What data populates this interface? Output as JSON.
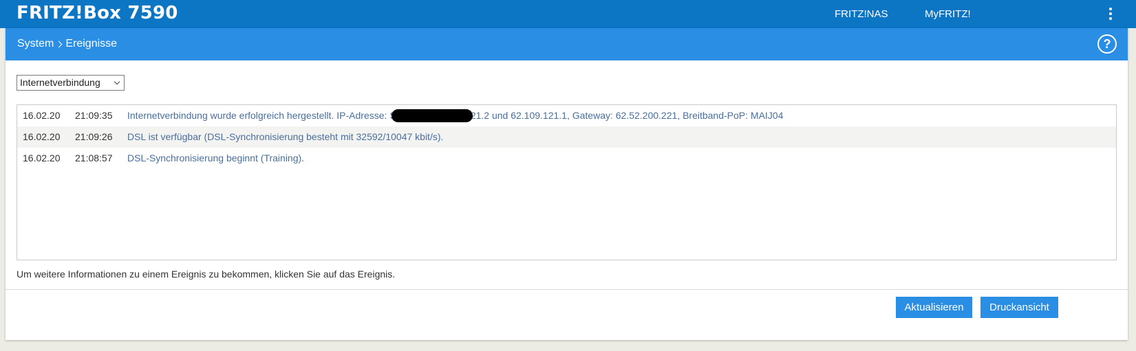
{
  "header": {
    "brand": "FRITZ!Box 7590",
    "links": [
      "FRITZ!NAS",
      "MyFRITZ!"
    ]
  },
  "breadcrumb": {
    "parent": "System",
    "current": "Ereignisse"
  },
  "help_label": "?",
  "filter": {
    "selected": "Internetverbindung"
  },
  "events": [
    {
      "date": "16.02.20",
      "time": "21:09:35",
      "message": "Internetverbindung wurde erfolgreich hergestellt. IP-Adresse:                                 S-Server: 62.109.121.2 und 62.109.121.1, Gateway: 62.52.200.221, Breitband-PoP: MAIJ04"
    },
    {
      "date": "16.02.20",
      "time": "21:09:26",
      "message": "DSL ist verfügbar (DSL-Synchronisierung besteht mit 32592/10047 kbit/s)."
    },
    {
      "date": "16.02.20",
      "time": "21:08:57",
      "message": "DSL-Synchronisierung beginnt (Training)."
    }
  ],
  "info_text": "Um weitere Informationen zu einem Ereignis zu bekommen, klicken Sie auf das Ereignis.",
  "buttons": {
    "refresh": "Aktualisieren",
    "print": "Druckansicht"
  },
  "colors": {
    "topbar": "#0c75c4",
    "subbar": "#2a8ee4",
    "button": "#2a8ee4",
    "link_text": "#4a6e9c"
  }
}
